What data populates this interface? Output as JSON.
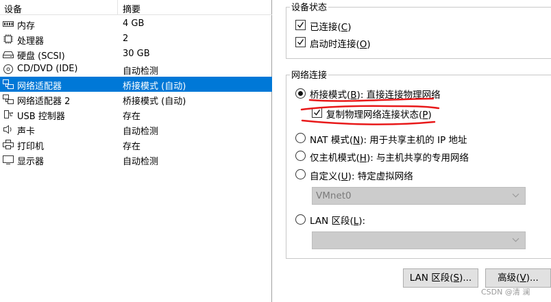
{
  "device_list": {
    "headers": {
      "device": "设备",
      "summary": "摘要"
    },
    "rows": [
      {
        "name": "内存",
        "summary": "4 GB",
        "icon": "memory-icon"
      },
      {
        "name": "处理器",
        "summary": "2",
        "icon": "processor-icon"
      },
      {
        "name": "硬盘 (SCSI)",
        "summary": "30 GB",
        "icon": "hard-disk-icon"
      },
      {
        "name": "CD/DVD (IDE)",
        "summary": "自动检测",
        "icon": "cd-dvd-icon"
      },
      {
        "name": "网络适配器",
        "summary": "桥接模式 (自动)",
        "icon": "network-adapter-icon",
        "selected": true
      },
      {
        "name": "网络适配器 2",
        "summary": "桥接模式 (自动)",
        "icon": "network-adapter-icon"
      },
      {
        "name": "USB 控制器",
        "summary": "存在",
        "icon": "usb-icon"
      },
      {
        "name": "声卡",
        "summary": "自动检测",
        "icon": "sound-card-icon"
      },
      {
        "name": "打印机",
        "summary": "存在",
        "icon": "printer-icon"
      },
      {
        "name": "显示器",
        "summary": "自动检测",
        "icon": "display-icon"
      }
    ]
  },
  "device_status": {
    "title": "设备状态",
    "connected": {
      "text": "已连接(",
      "key": "C",
      "tail": ")",
      "checked": true
    },
    "connect_at_power_on": {
      "text": "启动时连接(",
      "key": "O",
      "tail": ")",
      "checked": true
    }
  },
  "network_connection": {
    "title": "网络连接",
    "bridged": {
      "text": "桥接模式(",
      "key": "B",
      "tail": "): 直接连接物理网络",
      "selected": true
    },
    "replicate": {
      "text": "复制物理网络连接状态(",
      "key": "P",
      "tail": ")",
      "checked": true
    },
    "nat": {
      "text": "NAT 模式(",
      "key": "N",
      "tail": "): 用于共享主机的 IP 地址",
      "selected": false
    },
    "host_only": {
      "text": "仅主机模式(",
      "key": "H",
      "tail": "): 与主机共享的专用网络",
      "selected": false
    },
    "custom": {
      "text": "自定义(",
      "key": "U",
      "tail": "): 特定虚拟网络",
      "selected": false
    },
    "vmnet_value": "VMnet0",
    "lan_segment": {
      "text": "LAN 区段(",
      "key": "L",
      "tail": "):",
      "selected": false
    },
    "lan_segment_value": ""
  },
  "buttons": {
    "lan_segments": {
      "text": "LAN 区段(",
      "key": "S",
      "tail": ")..."
    },
    "advanced": {
      "text": "高级(",
      "key": "V",
      "tail": ")..."
    }
  },
  "watermark": "CSDN @清  澜",
  "colors": {
    "selection": "#0078d7",
    "annotation": "#e8191a"
  }
}
